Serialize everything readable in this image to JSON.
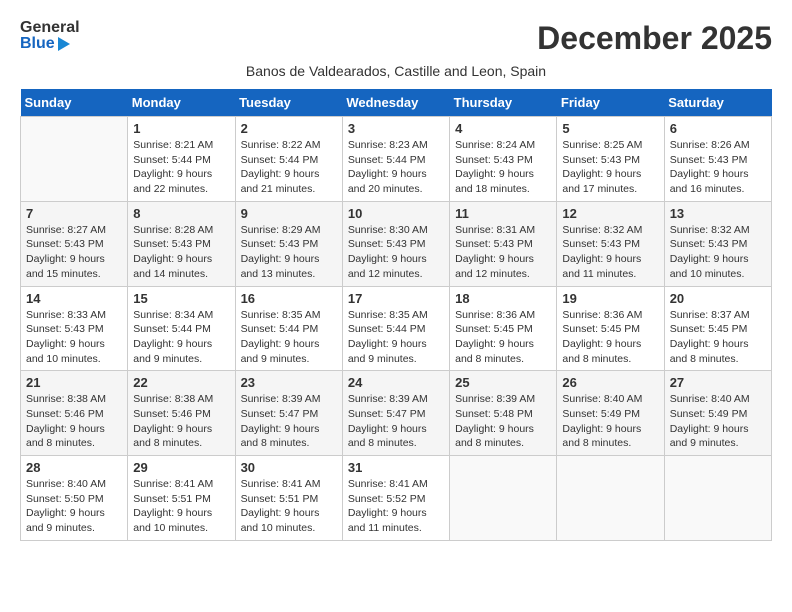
{
  "header": {
    "logo_general": "General",
    "logo_blue": "Blue",
    "month_year": "December 2025",
    "subtitle": "Banos de Valdearados, Castille and Leon, Spain"
  },
  "days_of_week": [
    "Sunday",
    "Monday",
    "Tuesday",
    "Wednesday",
    "Thursday",
    "Friday",
    "Saturday"
  ],
  "weeks": [
    [
      {
        "day": "",
        "sunrise": "",
        "sunset": "",
        "daylight": ""
      },
      {
        "day": "1",
        "sunrise": "Sunrise: 8:21 AM",
        "sunset": "Sunset: 5:44 PM",
        "daylight": "Daylight: 9 hours and 22 minutes."
      },
      {
        "day": "2",
        "sunrise": "Sunrise: 8:22 AM",
        "sunset": "Sunset: 5:44 PM",
        "daylight": "Daylight: 9 hours and 21 minutes."
      },
      {
        "day": "3",
        "sunrise": "Sunrise: 8:23 AM",
        "sunset": "Sunset: 5:44 PM",
        "daylight": "Daylight: 9 hours and 20 minutes."
      },
      {
        "day": "4",
        "sunrise": "Sunrise: 8:24 AM",
        "sunset": "Sunset: 5:43 PM",
        "daylight": "Daylight: 9 hours and 18 minutes."
      },
      {
        "day": "5",
        "sunrise": "Sunrise: 8:25 AM",
        "sunset": "Sunset: 5:43 PM",
        "daylight": "Daylight: 9 hours and 17 minutes."
      },
      {
        "day": "6",
        "sunrise": "Sunrise: 8:26 AM",
        "sunset": "Sunset: 5:43 PM",
        "daylight": "Daylight: 9 hours and 16 minutes."
      }
    ],
    [
      {
        "day": "7",
        "sunrise": "Sunrise: 8:27 AM",
        "sunset": "Sunset: 5:43 PM",
        "daylight": "Daylight: 9 hours and 15 minutes."
      },
      {
        "day": "8",
        "sunrise": "Sunrise: 8:28 AM",
        "sunset": "Sunset: 5:43 PM",
        "daylight": "Daylight: 9 hours and 14 minutes."
      },
      {
        "day": "9",
        "sunrise": "Sunrise: 8:29 AM",
        "sunset": "Sunset: 5:43 PM",
        "daylight": "Daylight: 9 hours and 13 minutes."
      },
      {
        "day": "10",
        "sunrise": "Sunrise: 8:30 AM",
        "sunset": "Sunset: 5:43 PM",
        "daylight": "Daylight: 9 hours and 12 minutes."
      },
      {
        "day": "11",
        "sunrise": "Sunrise: 8:31 AM",
        "sunset": "Sunset: 5:43 PM",
        "daylight": "Daylight: 9 hours and 12 minutes."
      },
      {
        "day": "12",
        "sunrise": "Sunrise: 8:32 AM",
        "sunset": "Sunset: 5:43 PM",
        "daylight": "Daylight: 9 hours and 11 minutes."
      },
      {
        "day": "13",
        "sunrise": "Sunrise: 8:32 AM",
        "sunset": "Sunset: 5:43 PM",
        "daylight": "Daylight: 9 hours and 10 minutes."
      }
    ],
    [
      {
        "day": "14",
        "sunrise": "Sunrise: 8:33 AM",
        "sunset": "Sunset: 5:43 PM",
        "daylight": "Daylight: 9 hours and 10 minutes."
      },
      {
        "day": "15",
        "sunrise": "Sunrise: 8:34 AM",
        "sunset": "Sunset: 5:44 PM",
        "daylight": "Daylight: 9 hours and 9 minutes."
      },
      {
        "day": "16",
        "sunrise": "Sunrise: 8:35 AM",
        "sunset": "Sunset: 5:44 PM",
        "daylight": "Daylight: 9 hours and 9 minutes."
      },
      {
        "day": "17",
        "sunrise": "Sunrise: 8:35 AM",
        "sunset": "Sunset: 5:44 PM",
        "daylight": "Daylight: 9 hours and 9 minutes."
      },
      {
        "day": "18",
        "sunrise": "Sunrise: 8:36 AM",
        "sunset": "Sunset: 5:45 PM",
        "daylight": "Daylight: 9 hours and 8 minutes."
      },
      {
        "day": "19",
        "sunrise": "Sunrise: 8:36 AM",
        "sunset": "Sunset: 5:45 PM",
        "daylight": "Daylight: 9 hours and 8 minutes."
      },
      {
        "day": "20",
        "sunrise": "Sunrise: 8:37 AM",
        "sunset": "Sunset: 5:45 PM",
        "daylight": "Daylight: 9 hours and 8 minutes."
      }
    ],
    [
      {
        "day": "21",
        "sunrise": "Sunrise: 8:38 AM",
        "sunset": "Sunset: 5:46 PM",
        "daylight": "Daylight: 9 hours and 8 minutes."
      },
      {
        "day": "22",
        "sunrise": "Sunrise: 8:38 AM",
        "sunset": "Sunset: 5:46 PM",
        "daylight": "Daylight: 9 hours and 8 minutes."
      },
      {
        "day": "23",
        "sunrise": "Sunrise: 8:39 AM",
        "sunset": "Sunset: 5:47 PM",
        "daylight": "Daylight: 9 hours and 8 minutes."
      },
      {
        "day": "24",
        "sunrise": "Sunrise: 8:39 AM",
        "sunset": "Sunset: 5:47 PM",
        "daylight": "Daylight: 9 hours and 8 minutes."
      },
      {
        "day": "25",
        "sunrise": "Sunrise: 8:39 AM",
        "sunset": "Sunset: 5:48 PM",
        "daylight": "Daylight: 9 hours and 8 minutes."
      },
      {
        "day": "26",
        "sunrise": "Sunrise: 8:40 AM",
        "sunset": "Sunset: 5:49 PM",
        "daylight": "Daylight: 9 hours and 8 minutes."
      },
      {
        "day": "27",
        "sunrise": "Sunrise: 8:40 AM",
        "sunset": "Sunset: 5:49 PM",
        "daylight": "Daylight: 9 hours and 9 minutes."
      }
    ],
    [
      {
        "day": "28",
        "sunrise": "Sunrise: 8:40 AM",
        "sunset": "Sunset: 5:50 PM",
        "daylight": "Daylight: 9 hours and 9 minutes."
      },
      {
        "day": "29",
        "sunrise": "Sunrise: 8:41 AM",
        "sunset": "Sunset: 5:51 PM",
        "daylight": "Daylight: 9 hours and 10 minutes."
      },
      {
        "day": "30",
        "sunrise": "Sunrise: 8:41 AM",
        "sunset": "Sunset: 5:51 PM",
        "daylight": "Daylight: 9 hours and 10 minutes."
      },
      {
        "day": "31",
        "sunrise": "Sunrise: 8:41 AM",
        "sunset": "Sunset: 5:52 PM",
        "daylight": "Daylight: 9 hours and 11 minutes."
      },
      {
        "day": "",
        "sunrise": "",
        "sunset": "",
        "daylight": ""
      },
      {
        "day": "",
        "sunrise": "",
        "sunset": "",
        "daylight": ""
      },
      {
        "day": "",
        "sunrise": "",
        "sunset": "",
        "daylight": ""
      }
    ]
  ]
}
